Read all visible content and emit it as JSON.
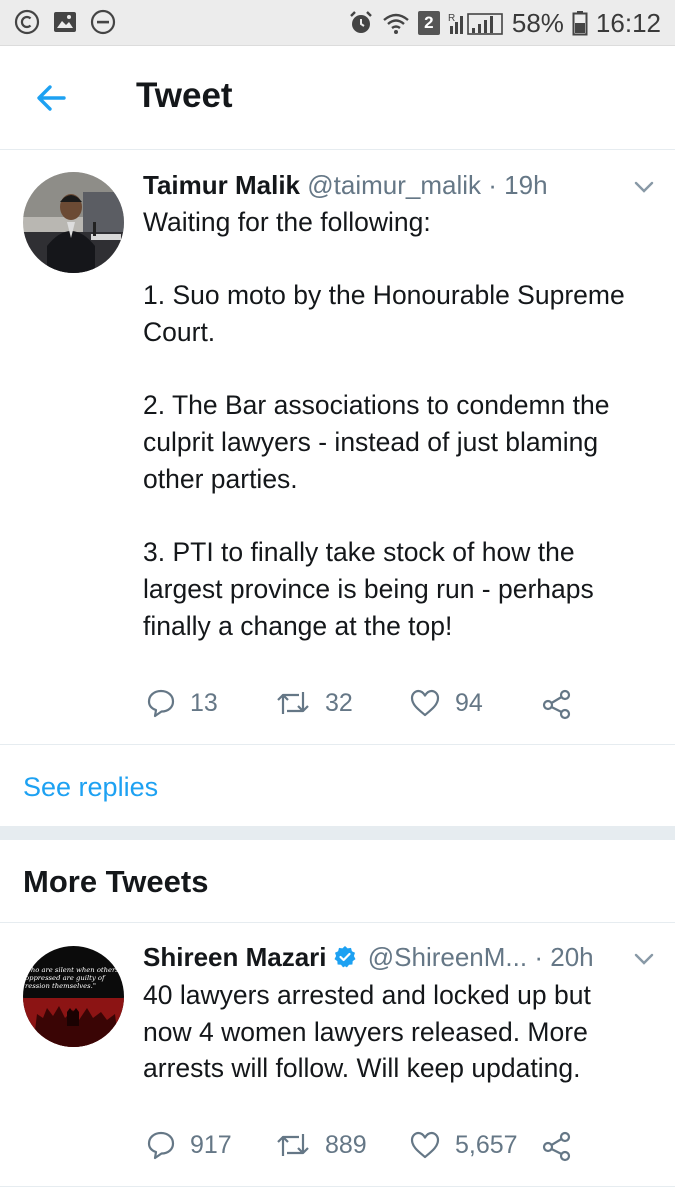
{
  "status_bar": {
    "battery": "58%",
    "time": "16:12",
    "sim_badge": "2",
    "left_icons": [
      "circle-c-icon",
      "image-icon",
      "do-not-disturb-icon"
    ],
    "right_icons": [
      "alarm-icon",
      "wifi-icon",
      "signal-icon",
      "battery-icon"
    ]
  },
  "header": {
    "title": "Tweet",
    "back_icon": "arrow-left-icon"
  },
  "main_tweet": {
    "name": "Taimur Malik",
    "handle": "@taimur_malik",
    "separator": "·",
    "time": "19h",
    "lines": [
      "Waiting for the following:",
      "",
      "1. Suo moto by the Honourable Supreme",
      "Court.",
      "",
      "2. The Bar associations to condemn the",
      "culprit lawyers - instead of just blaming",
      "other parties.",
      "",
      "3. PTI to finally take stock of how the",
      "largest province is being run - perhaps",
      "finally a change at the top!"
    ],
    "replies": "13",
    "retweets": "32",
    "likes": "94"
  },
  "see_replies": "See replies",
  "more_tweets_title": "More Tweets",
  "second_tweet": {
    "name": "Shireen Mazari",
    "handle": "@ShireenM...",
    "separator": "·",
    "time": "20h",
    "avatar_text": [
      "who are silent when others",
      "oppressed are guilty of",
      "ression themselves.\""
    ],
    "lines": [
      "40 lawyers arrested and locked up but",
      "now 4 women lawyers released. More",
      "arrests will follow. Will keep updating."
    ],
    "replies": "917",
    "retweets": "889",
    "likes": "5,657"
  },
  "colors": {
    "accent": "#1da1f2",
    "secondary_text": "#657786",
    "divider": "#e6ecf0"
  }
}
